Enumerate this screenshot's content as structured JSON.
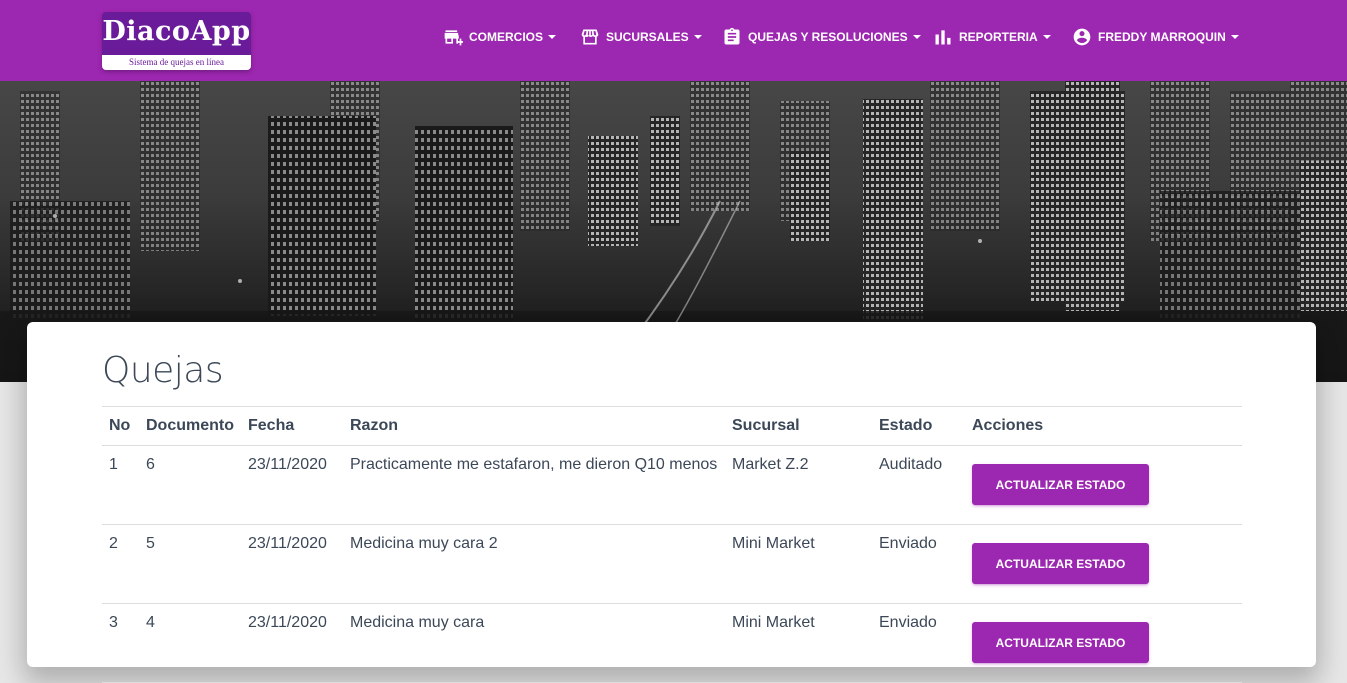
{
  "brand": {
    "title": "DiacoApp",
    "subtitle": "Sistema de quejas en línea",
    "color": "#9c27b0"
  },
  "nav": [
    {
      "label": "COMERCIOS",
      "icon": "store-add-icon"
    },
    {
      "label": "SUCURSALES",
      "icon": "storefront-icon"
    },
    {
      "label": "QUEJAS Y RESOLUCIONES",
      "icon": "clipboard-icon"
    },
    {
      "label": "REPORTERIA",
      "icon": "bar-chart-icon"
    },
    {
      "label": "FREDDY MARROQUIN",
      "icon": "account-circle-icon"
    }
  ],
  "main": {
    "title": "Quejas",
    "columns": [
      "No",
      "Documento",
      "Fecha",
      "Razon",
      "Sucursal",
      "Estado",
      "Acciones"
    ],
    "action_label": "ACTUALIZAR ESTADO",
    "rows": [
      {
        "no": "1",
        "documento": "6",
        "fecha": "23/11/2020",
        "razon": "Practicamente me estafaron, me dieron Q10 menos",
        "sucursal": "Market Z.2",
        "estado": "Auditado"
      },
      {
        "no": "2",
        "documento": "5",
        "fecha": "23/11/2020",
        "razon": "Medicina muy cara 2",
        "sucursal": "Mini Market",
        "estado": "Enviado"
      },
      {
        "no": "3",
        "documento": "4",
        "fecha": "23/11/2020",
        "razon": "Medicina muy cara",
        "sucursal": "Mini Market",
        "estado": "Enviado"
      }
    ]
  }
}
